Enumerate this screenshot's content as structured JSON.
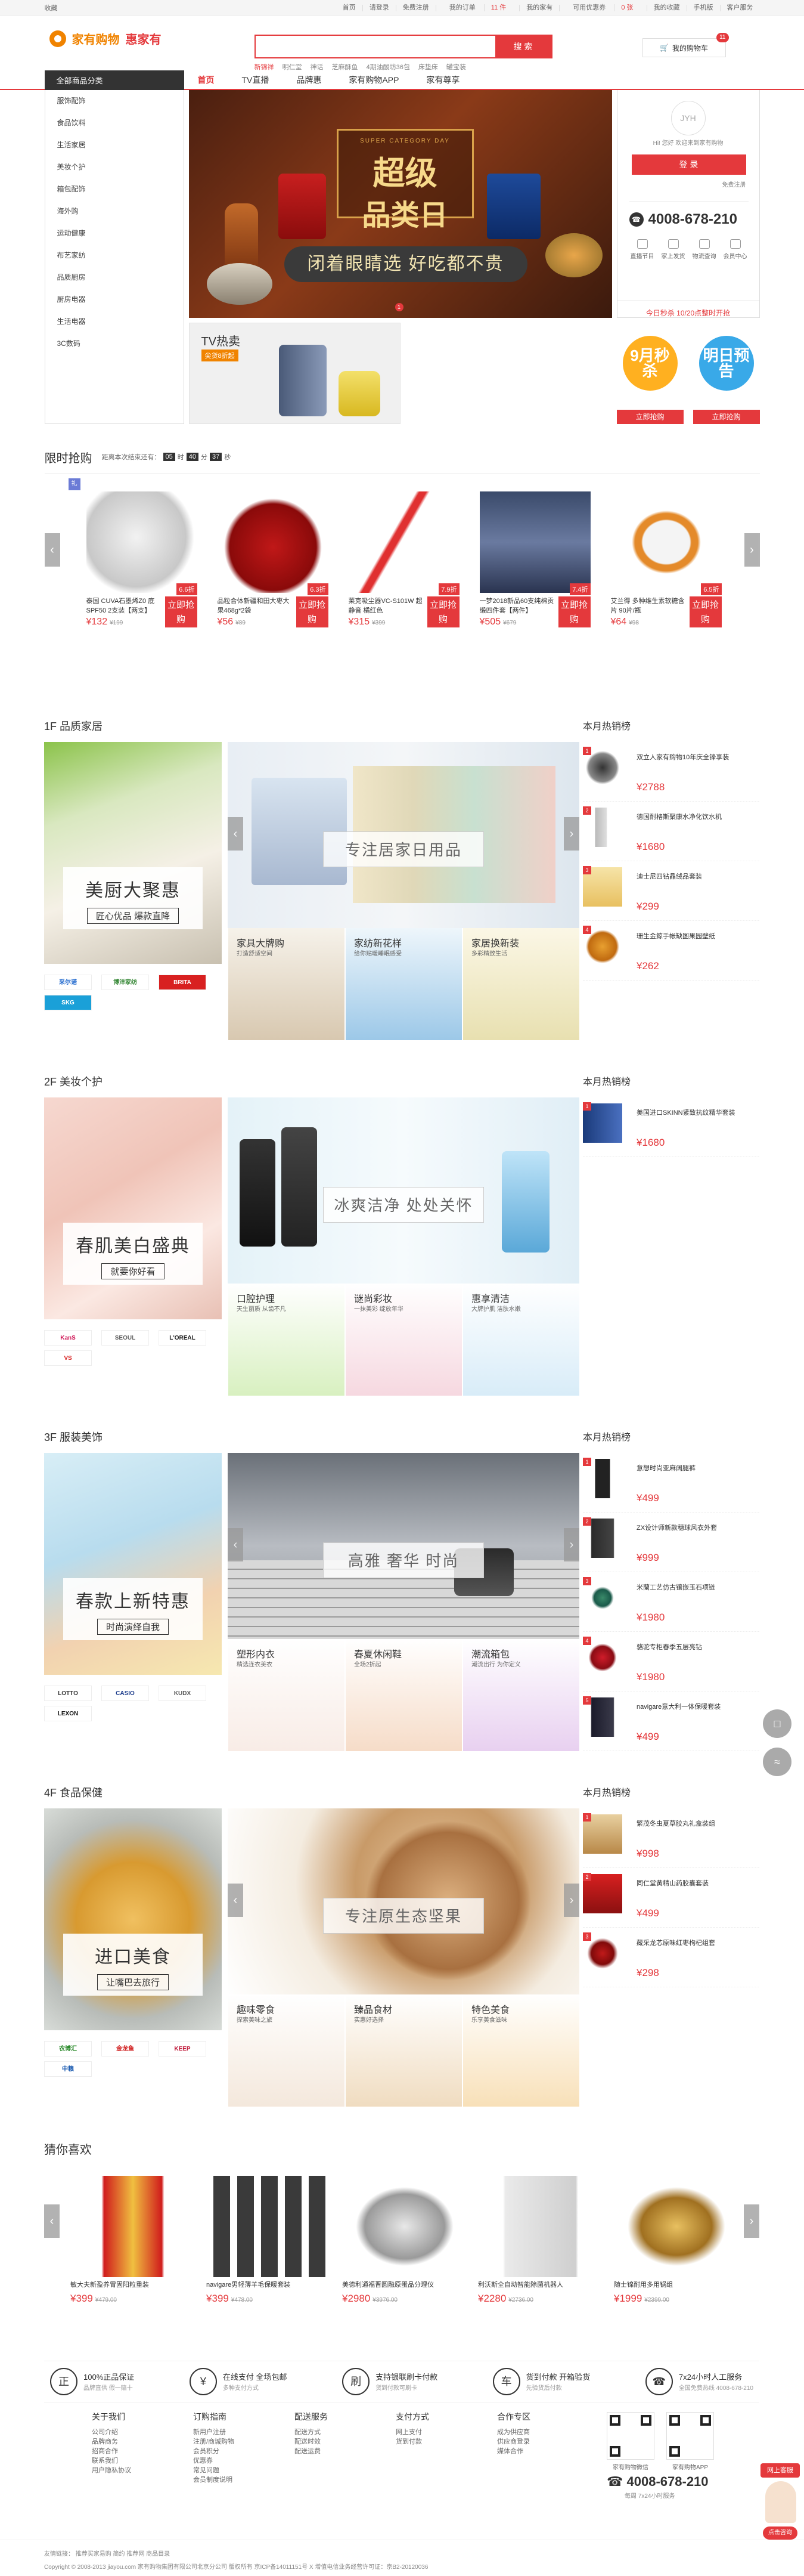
{
  "topbar": {
    "left": "收藏",
    "links": [
      "首页",
      "请登录",
      "免费注册",
      "我的订单",
      "我的家有",
      "可用优惠券",
      "我的收藏",
      "手机版",
      "客户服务"
    ],
    "order_count": "11 件",
    "coupons": "0 张",
    "city": "欢迎"
  },
  "logo": {
    "a": "家有购物",
    "b": "惠家有"
  },
  "search": {
    "button": "搜 索",
    "placeholder": "",
    "hot": [
      "新锦祥",
      "明仁堂",
      "神话",
      "芝麻酥鱼",
      "4期油酸坊36包",
      "床垫床",
      "罐宝装"
    ]
  },
  "cart": {
    "label": "我的购物车",
    "count": "11"
  },
  "nav": {
    "all": "全部商品分类",
    "items": [
      "首页",
      "TV直播",
      "品牌惠",
      "家有购物APP",
      "家有尊享"
    ]
  },
  "categories": [
    "服饰配饰",
    "食品饮料",
    "生活家居",
    "美妆个护",
    "箱包配饰",
    "海外购",
    "运动健康",
    "布艺家纺",
    "品质厨房",
    "厨房电器",
    "生活电器",
    "3C数码"
  ],
  "slide": {
    "small": "SUPER CATEGORY DAY",
    "title1": "超级",
    "title2": "品类日",
    "bar": "闭着眼睛选 好吃都不贵",
    "dot": "1"
  },
  "tvsale": {
    "title": "TV热卖",
    "sub": "尖货8折起"
  },
  "user": {
    "avatar": "JYH",
    "greeting": "Hi! 您好 欢迎来到家有购物",
    "login": "登 录",
    "register": "免费注册",
    "phone": "4008-678-210",
    "services": [
      "直播节目",
      "家上发货",
      "物流查询",
      "会员中心"
    ],
    "announce": "今日秒杀 10/20点整时开抢"
  },
  "promos": [
    {
      "label": "9月秒杀",
      "button": "立即抢购",
      "color": "#ffb020"
    },
    {
      "label": "明日预告",
      "button": "立即抢购",
      "color": "#39a9e8"
    }
  ],
  "flash": {
    "title": "限时抢购",
    "countdown_label": "距离本次结束还有：",
    "h": "05",
    "m": "40",
    "s": "37",
    "tag": "礼",
    "items": [
      {
        "name": "泰国 CUVA石墨烯Z0 底SPF50 2支装【两支】",
        "discount": "6.6折",
        "price": "¥132",
        "old": "¥199",
        "buy": "立即抢购"
      },
      {
        "name": "品粒合体新疆和田大枣大果468g*2袋",
        "discount": "6.3折",
        "price": "¥56",
        "old": "¥89",
        "buy": "立即抢购"
      },
      {
        "name": "莱克吸尘器VC-S101W 超静音 橘红色",
        "discount": "7.9折",
        "price": "¥315",
        "old": "¥399",
        "buy": "立即抢购"
      },
      {
        "name": "一梦2018新品60支纯棉贡缎四件套【两件】",
        "discount": "7.4折",
        "price": "¥505",
        "old": "¥679",
        "buy": "立即抢购"
      },
      {
        "name": "艾兰得 多种维生素软糖含片 90片/瓶",
        "discount": "6.5折",
        "price": "¥64",
        "old": "¥98",
        "buy": "立即抢购"
      }
    ]
  },
  "floors": [
    {
      "title": "1F 品质家居",
      "rank_title": "本月热销榜",
      "slogan_a": "美厨大聚惠",
      "slogan_b": "匠心优品 爆款直降",
      "caption": "专注居家日用品",
      "brands": [
        "采尔诺",
        "博洋家纺",
        "BRITA",
        "SKG"
      ],
      "subs": [
        {
          "t": "家具大牌购",
          "s": "打造舒适空间"
        },
        {
          "t": "家纺新花样",
          "s": "给你贴暖睡眠感受"
        },
        {
          "t": "家居换新装",
          "s": "多彩精致生活"
        }
      ],
      "rank": [
        {
          "n": "双立人家有购物10年庆全锋享装",
          "p": "¥2788"
        },
        {
          "n": "德国耐格斯聚康水净化饮水机",
          "p": "¥1680"
        },
        {
          "n": "迪士尼四钻晶绒品套装",
          "p": "¥299"
        },
        {
          "n": "珊生金鲸手帐缺图果园壁纸",
          "p": "¥262"
        }
      ]
    },
    {
      "title": "2F 美妆个护",
      "rank_title": "本月热销榜",
      "slogan_a": "春肌美白盛典",
      "slogan_b": "就要你好看",
      "caption": "冰爽洁净 处处关怀",
      "brands": [
        "KanS",
        "SEOUL",
        "L'OREAL",
        "VS"
      ],
      "subs": [
        {
          "t": "口腔护理",
          "s": "天生丽质 从齿不凡"
        },
        {
          "t": "谜尚彩妆",
          "s": "一抹美彩 绽放年华"
        },
        {
          "t": "惠享清洁",
          "s": "大牌护肌 洁肤水嫩"
        }
      ],
      "rank": [
        {
          "n": "美国进口SKINN紧致抗纹精华套装",
          "p": "¥1680"
        }
      ]
    },
    {
      "title": "3F 服装美饰",
      "rank_title": "本月热销榜",
      "slogan_a": "春款上新特惠",
      "slogan_b": "时尚演绎自我",
      "caption": "高雅 奢华 时尚",
      "brands": [
        "LOTTO",
        "CASIO",
        "KUDX",
        "LEXON"
      ],
      "subs": [
        {
          "t": "塑形内衣",
          "s": "精选连衣美衣"
        },
        {
          "t": "春夏休闲鞋",
          "s": "全场2折起"
        },
        {
          "t": "潮流箱包",
          "s": "潮流出行 为你定义"
        }
      ],
      "rank": [
        {
          "n": "意想时尚亚麻阔腿裤",
          "p": "¥499"
        },
        {
          "n": "ZX设计师新款穗球风衣外套",
          "p": "¥999"
        },
        {
          "n": "米蘭工艺仿古镶嵌玉石项链",
          "p": "¥1980"
        },
        {
          "n": "骆驼专柜春季五层亮钻",
          "p": "¥1980"
        },
        {
          "n": "navigare意大利一体保暖套装",
          "p": "¥499"
        }
      ]
    },
    {
      "title": "4F 食品保健",
      "rank_title": "本月热销榜",
      "slogan_a": "进口美食",
      "slogan_b": "让嘴巴去旅行",
      "caption": "专注原生态坚果",
      "brands": [
        "农博汇",
        "金龙鱼",
        "KEEP",
        "中粮"
      ],
      "subs": [
        {
          "t": "趣味零食",
          "s": "探索美味之旅"
        },
        {
          "t": "臻品食材",
          "s": "实惠好选择"
        },
        {
          "t": "特色美食",
          "s": "乐享美食滋味"
        }
      ],
      "rank": [
        {
          "n": "繁茂冬虫夏草胶丸礼盒装组",
          "p": "¥998"
        },
        {
          "n": "同仁堂黄精山药胶囊套装",
          "p": "¥499"
        },
        {
          "n": "藏采龙芯原味红枣枸杞组套",
          "p": "¥298"
        }
      ]
    }
  ],
  "guess": {
    "title": "猜你喜欢",
    "items": [
      {
        "n": "敏大夫新盈养胃固阳粒重装",
        "p": "¥399",
        "o": "¥479.00"
      },
      {
        "n": "navigare男轻薄羊毛保暖套装",
        "p": "¥399",
        "o": "¥478.00"
      },
      {
        "n": "美德利通福晋圆融原蛋品分理仪",
        "p": "¥2980",
        "o": "¥3976.00"
      },
      {
        "n": "利沃斯全自动智能除菌机器人",
        "p": "¥2280",
        "o": "¥2736.00"
      },
      {
        "n": "随士锦耐用多用锅组",
        "p": "¥1999",
        "o": "¥2399.00"
      }
    ]
  },
  "guarantee": [
    {
      "i": "正",
      "t": "100%正品保证",
      "s": "品牌直供 假一赔十"
    },
    {
      "i": "¥",
      "t": "在线支付 全场包邮",
      "s": "多种支付方式"
    },
    {
      "i": "刷",
      "t": "支持银联刷卡付款",
      "s": "货到付款可刷卡"
    },
    {
      "i": "车",
      "t": "货到付款 开箱验货",
      "s": "先验货后付款"
    },
    {
      "i": "☎",
      "t": "7x24小时人工服务",
      "s": "全国免费热线 4008-678-210"
    }
  ],
  "footer_cols": [
    {
      "h": "关于我们",
      "items": [
        "公司介绍",
        "品牌商务",
        "招商合作",
        "联系我们",
        "用户隐私协议"
      ]
    },
    {
      "h": "订购指南",
      "items": [
        "新用户注册",
        "注册/商城购物",
        "会员积分",
        "优惠券",
        "常见问题",
        "会员制度说明"
      ]
    },
    {
      "h": "配送服务",
      "items": [
        "配送方式",
        "配送时效",
        "配送运费"
      ]
    },
    {
      "h": "支付方式",
      "items": [
        "网上支付",
        "货到付款"
      ]
    },
    {
      "h": "合作专区",
      "items": [
        "成为供应商",
        "供应商登录",
        "媒体合作"
      ]
    }
  ],
  "qr": [
    "家有购物微信",
    "家有购物APP"
  ],
  "footer_phone": "4008-678-210",
  "footer_sub": "每周 7x24小时服务",
  "bottom": {
    "l1": "友情链接：  推荐买家易购  简约 推荐网   商品目录",
    "l2": "Copyright © 2008-2013 jiayou.com 家有购物集团有限公司北京分公司 版权所有 京ICP备14011151号 X 增值电信业务经营许可证：京B2-20120036"
  },
  "service": {
    "label": "网上客服",
    "btn": "点击咨询"
  },
  "float": [
    "□",
    "≈"
  ]
}
